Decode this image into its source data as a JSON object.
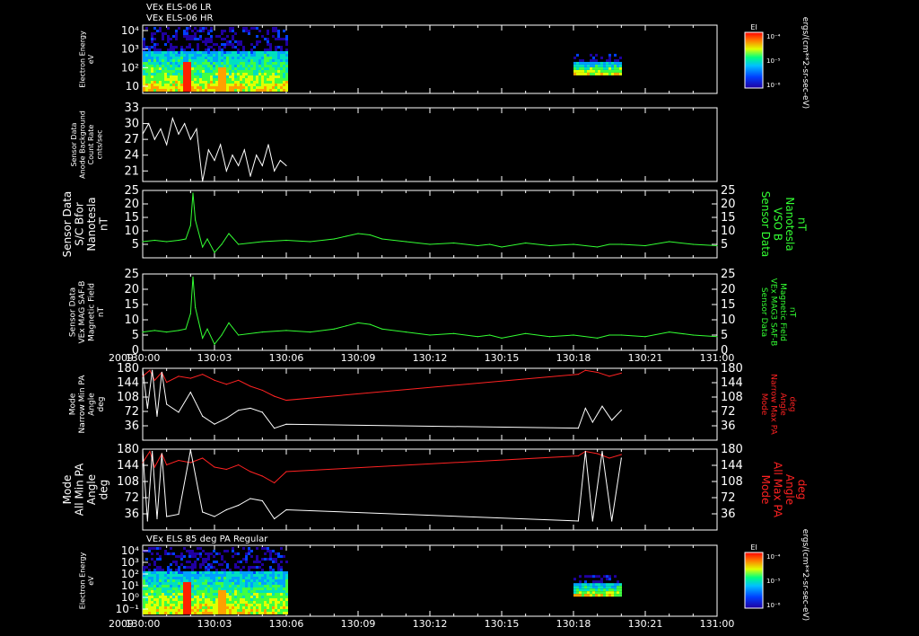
{
  "header": {
    "title_lr": "VEx ELS-06 LR",
    "title_hr": "VEx ELS-06 HR",
    "bottom_title": "VEx ELS 85 deg PA Regular"
  },
  "time_axis": {
    "year": "2009",
    "ticks": [
      "130:00",
      "130:03",
      "130:06",
      "130:09",
      "130:12",
      "130:15",
      "130:18",
      "130:21",
      "131:00"
    ]
  },
  "colors": {
    "background": "#000000",
    "green_trace": "#33ff33",
    "red_trace": "#ff2222",
    "white_trace": "#ffffff",
    "frame": "#ffffff"
  },
  "colorbar": {
    "title": "El",
    "unit": "ergs/(cm**2-sr-sec-eV)",
    "ticks_top": [
      "10⁻⁴",
      "10⁻⁵",
      "10⁻⁶"
    ],
    "ticks_bottom": [
      "10⁻⁴",
      "10⁻⁵",
      "10⁻⁶"
    ]
  },
  "chart_data": [
    {
      "type": "heatmap",
      "ylabel": [
        "Electron Energy",
        "eV"
      ],
      "yscale": "log",
      "yticks": [
        "10⁴",
        "10³",
        "10²",
        "10"
      ],
      "data_windows": [
        [
          "130:00",
          "130:06"
        ],
        [
          "130:18",
          "130:20"
        ]
      ],
      "colorbar": "El"
    },
    {
      "type": "line",
      "ylabel": [
        "Sensor Data",
        "Anode Background",
        "Count Rate",
        "cnts/sec"
      ],
      "ylim": [
        19,
        33
      ],
      "yticks": [
        "33",
        "30",
        "27",
        "24",
        "21"
      ],
      "series": [
        {
          "color": "white",
          "x": [
            0.0,
            0.25,
            0.5,
            0.75,
            1.0,
            1.25,
            1.5,
            1.75,
            2.0,
            2.25,
            2.5,
            2.75,
            3.0,
            3.25,
            3.5,
            3.75,
            4.0,
            4.25,
            4.5,
            4.75,
            5.0,
            5.25,
            5.5,
            5.75,
            6.0
          ],
          "values": [
            28,
            30,
            27,
            29,
            26,
            31,
            28,
            30,
            27,
            29,
            19,
            25,
            23,
            26,
            21,
            24,
            22,
            25,
            20,
            24,
            22,
            26,
            21,
            23,
            22
          ]
        }
      ]
    },
    {
      "type": "line",
      "ylabel": [
        "Sensor Data",
        "S/C Bfor",
        "Nanotesla",
        "nT"
      ],
      "ylabel_right": [
        "Sensor Data",
        "VSO B",
        "Nanotesla",
        "nT"
      ],
      "ylim": [
        0,
        25
      ],
      "yticks": [
        "25",
        "20",
        "15",
        "10",
        "5"
      ],
      "series": [
        {
          "color": "green",
          "x": [
            0.0,
            0.5,
            1.0,
            1.5,
            1.8,
            2.0,
            2.1,
            2.2,
            2.5,
            2.7,
            3.0,
            3.3,
            3.6,
            4.0,
            5.0,
            6.0,
            7.0,
            8.0,
            8.5,
            9.0,
            9.5,
            10.0,
            11.0,
            12.0,
            13.0,
            14.0,
            14.5,
            15.0,
            16.0,
            17.0,
            18.0,
            19.0,
            19.5,
            20.0,
            21.0,
            22.0,
            23.0,
            24.0
          ],
          "values": [
            6,
            6.5,
            6,
            6.5,
            7,
            12,
            24,
            14,
            4,
            7,
            2,
            5,
            9,
            5,
            6,
            6.5,
            6,
            7,
            8,
            9,
            8.5,
            7,
            6,
            5,
            5.5,
            4.5,
            5,
            4,
            5.5,
            4.5,
            5,
            4,
            5,
            5,
            4.5,
            6,
            5,
            4.5
          ]
        }
      ]
    },
    {
      "type": "line",
      "ylabel": [
        "Sensor Data",
        "VEx MAG SAF-B",
        "Magnetic Field",
        "nT"
      ],
      "ylabel_right": [
        "Sensor Data",
        "VEx MAG3 SAF-B",
        "Magnetic Field",
        "nT"
      ],
      "ylim": [
        0,
        25
      ],
      "yticks": [
        "25",
        "20",
        "15",
        "10",
        "5",
        "0"
      ],
      "series": [
        {
          "color": "green",
          "x": [
            0.0,
            0.5,
            1.0,
            1.5,
            1.8,
            2.0,
            2.1,
            2.2,
            2.5,
            2.7,
            3.0,
            3.3,
            3.6,
            4.0,
            5.0,
            6.0,
            7.0,
            8.0,
            8.5,
            9.0,
            9.5,
            10.0,
            11.0,
            12.0,
            13.0,
            14.0,
            14.5,
            15.0,
            16.0,
            17.0,
            18.0,
            19.0,
            19.5,
            20.0,
            21.0,
            22.0,
            23.0,
            24.0
          ],
          "values": [
            6,
            6.5,
            6,
            6.5,
            7,
            12,
            24,
            14,
            4,
            7,
            2,
            5,
            9,
            5,
            6,
            6.5,
            6,
            7,
            8,
            9,
            8.5,
            7,
            6,
            5,
            5.5,
            4.5,
            5,
            4,
            5.5,
            4.5,
            5,
            4,
            5,
            5,
            4.5,
            6,
            5,
            4.5
          ]
        }
      ]
    },
    {
      "type": "line",
      "ylabel": [
        "Mode",
        "Narrow Min PA",
        "Angle",
        "deg"
      ],
      "ylabel_right": [
        "Mode",
        "Narrow Max PA",
        "Angle",
        "deg"
      ],
      "ylim": [
        0,
        180
      ],
      "yticks": [
        "180",
        "144",
        "108",
        "72",
        "36"
      ],
      "series": [
        {
          "color": "red",
          "x": [
            0.0,
            0.3,
            0.5,
            0.8,
            1.0,
            1.5,
            2.0,
            2.5,
            3.0,
            3.5,
            4.0,
            4.5,
            5.0,
            5.5,
            6.0,
            18.2,
            18.5,
            19.0,
            19.5,
            20.0
          ],
          "values": [
            160,
            175,
            150,
            170,
            145,
            160,
            155,
            165,
            150,
            140,
            150,
            135,
            125,
            110,
            100,
            165,
            175,
            170,
            160,
            168
          ]
        },
        {
          "color": "white",
          "x": [
            0.0,
            0.2,
            0.4,
            0.6,
            0.8,
            1.0,
            1.5,
            2.0,
            2.5,
            3.0,
            3.5,
            4.0,
            4.5,
            5.0,
            5.5,
            6.0,
            18.2,
            18.5,
            18.8,
            19.2,
            19.6,
            20.0
          ],
          "values": [
            178,
            80,
            175,
            60,
            170,
            90,
            70,
            120,
            60,
            40,
            55,
            75,
            80,
            70,
            30,
            40,
            30,
            80,
            45,
            85,
            50,
            75
          ]
        }
      ]
    },
    {
      "type": "line",
      "ylabel": [
        "Mode",
        "All Min PA",
        "Angle",
        "deg"
      ],
      "ylabel_right": [
        "Mode",
        "All Max PA",
        "Angle",
        "deg"
      ],
      "ylim": [
        0,
        180
      ],
      "yticks": [
        "180",
        "144",
        "108",
        "72",
        "36"
      ],
      "series": [
        {
          "color": "red",
          "x": [
            0.0,
            0.3,
            0.5,
            0.8,
            1.0,
            1.5,
            2.0,
            2.5,
            3.0,
            3.5,
            4.0,
            4.5,
            5.0,
            5.5,
            6.0,
            18.2,
            18.5,
            19.0,
            19.5,
            20.0
          ],
          "values": [
            150,
            175,
            140,
            170,
            145,
            155,
            150,
            160,
            140,
            135,
            145,
            130,
            120,
            105,
            130,
            165,
            175,
            170,
            160,
            168
          ]
        },
        {
          "color": "white",
          "x": [
            0.0,
            0.2,
            0.4,
            0.6,
            0.8,
            1.0,
            1.5,
            2.0,
            2.5,
            3.0,
            3.5,
            4.0,
            4.5,
            5.0,
            5.5,
            6.0,
            18.2,
            18.5,
            18.8,
            19.2,
            19.6,
            20.0
          ],
          "values": [
            178,
            20,
            175,
            25,
            170,
            30,
            35,
            178,
            40,
            30,
            45,
            55,
            70,
            65,
            25,
            45,
            20,
            175,
            20,
            175,
            20,
            160
          ]
        }
      ]
    },
    {
      "type": "heatmap",
      "ylabel": [
        "Electron Energy",
        "eV"
      ],
      "yscale": "log",
      "yticks": [
        "10⁴",
        "10³",
        "10²",
        "10¹",
        "10⁰",
        "10⁻¹"
      ],
      "data_windows": [
        [
          "130:00",
          "130:06"
        ],
        [
          "130:18",
          "130:20"
        ]
      ],
      "colorbar": "El"
    }
  ]
}
